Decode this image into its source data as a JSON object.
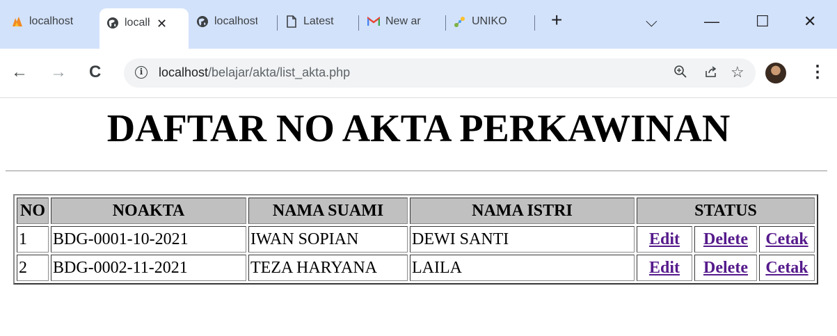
{
  "browser": {
    "tabs": [
      {
        "title": "localhost",
        "icon": "xampp-icon"
      },
      {
        "title": "localhost",
        "icon": "globe-icon",
        "active": true
      },
      {
        "title": "localhost",
        "icon": "globe-icon"
      },
      {
        "title": "Latest",
        "icon": "document-icon"
      },
      {
        "title": "New ar",
        "icon": "gmail-icon"
      },
      {
        "title": "UNIKO",
        "icon": "network-icon"
      }
    ],
    "new_tab_symbol": "+",
    "window_controls": {
      "dropdown": "⌵",
      "minimize": "—",
      "maximize": "☐",
      "close": "✕"
    },
    "url_host": "localhost",
    "url_path": "/belajar/akta/list_akta.php"
  },
  "page": {
    "title": "DAFTAR NO AKTA PERKAWINAN",
    "table": {
      "headers": [
        "NO",
        "NOAKTA",
        "NAMA SUAMI",
        "NAMA ISTRI",
        "STATUS"
      ],
      "rows": [
        {
          "no": "1",
          "noakta": "BDG-0001-10-2021",
          "suami": "IWAN SOPIAN",
          "istri": "DEWI SANTI"
        },
        {
          "no": "2",
          "noakta": "BDG-0002-11-2021",
          "suami": "TEZA HARYANA",
          "istri": "LAILA"
        }
      ],
      "actions": {
        "edit": "Edit",
        "delete": "Delete",
        "cetak": "Cetak"
      }
    }
  },
  "colors": {
    "tabstrip": "#d3e2fb",
    "link_visited": "#551a8b",
    "header_bg": "#c0c0c0"
  }
}
